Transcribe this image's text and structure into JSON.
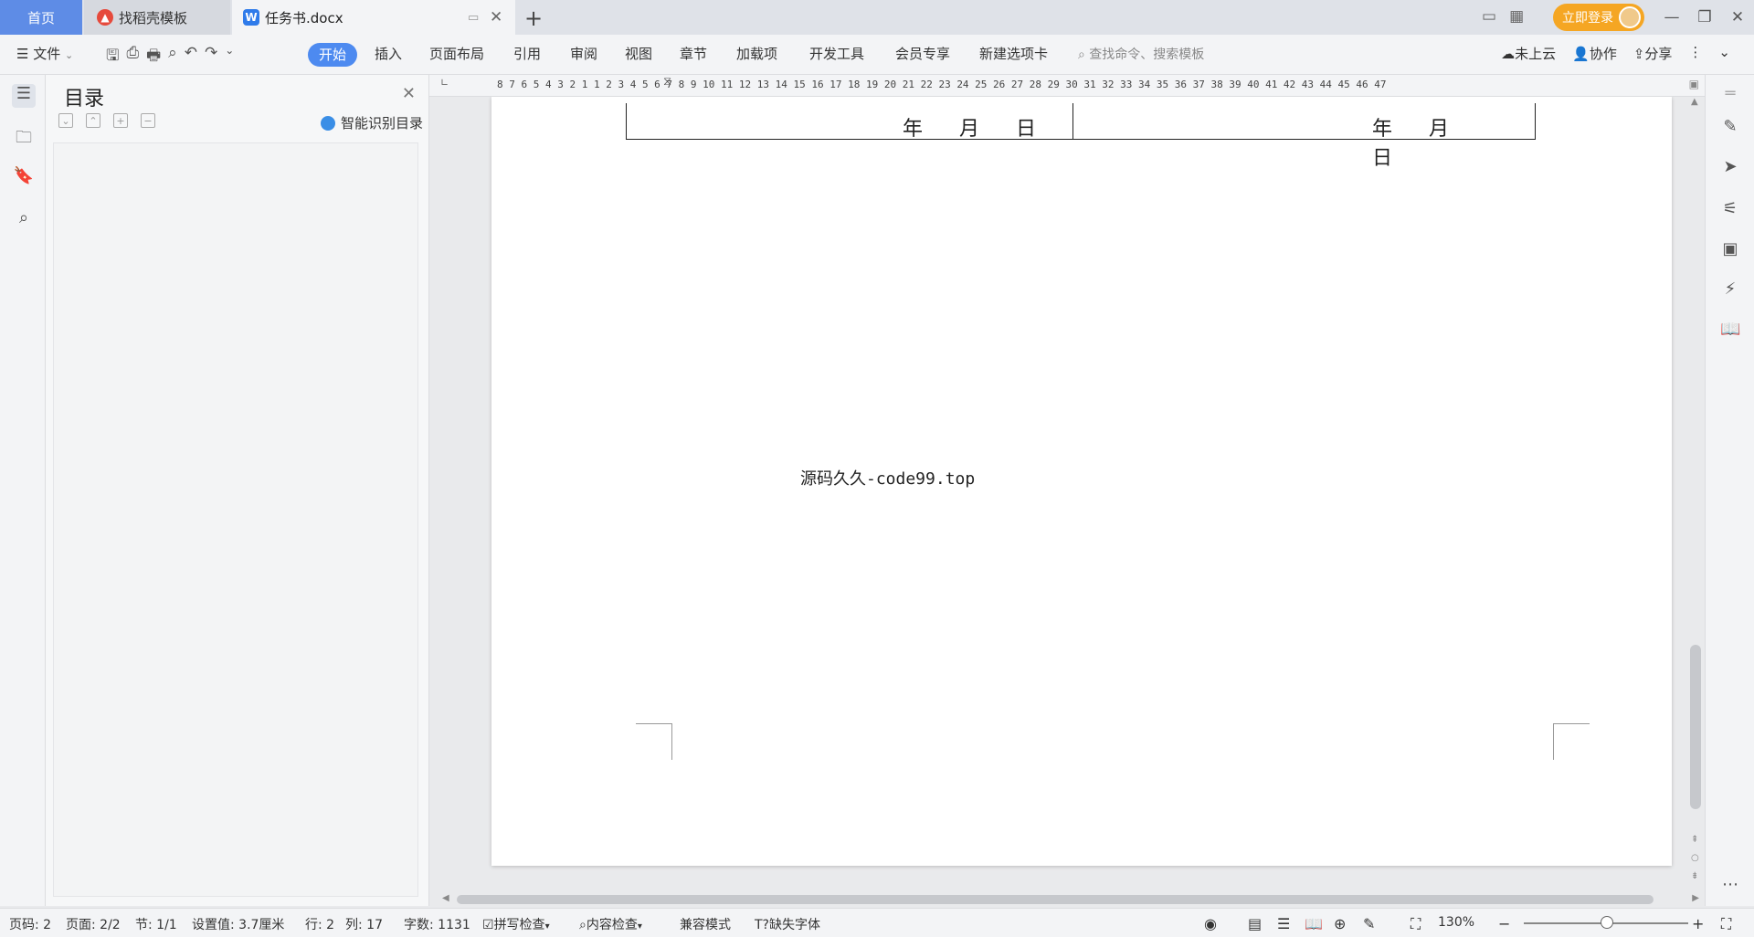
{
  "tabs": {
    "home": "首页",
    "daoke": "找稻壳模板",
    "doc": "任务书.docx",
    "login": "立即登录"
  },
  "menu": {
    "file": "文件",
    "start": "开始",
    "items": [
      "插入",
      "页面布局",
      "引用",
      "审阅",
      "视图",
      "章节",
      "加载项",
      "开发工具",
      "会员专享",
      "新建选项卡"
    ],
    "search_placeholder": "查找命令、搜索模板",
    "cloud": "未上云",
    "collab": "协作",
    "share": "分享"
  },
  "toc": {
    "title": "目录",
    "smart_label": "智能识别目录"
  },
  "ruler": "8  7  6  5  4  3  2  1     1  2  3  4  5  6  7  8  9 10 11 12 13 14 15 16 17 18 19 20 21 22 23 24 25 26 27 28 29 30 31 32 33 34 35 36 37 38 39 40 41 42 43 44 45 46 47",
  "document": {
    "date_left": "年月日",
    "date_right": "年月日",
    "watermark": "源码久久-code99.top"
  },
  "status": {
    "page_code": "页码: 2",
    "pages": "页面: 2/2",
    "section": "节: 1/1",
    "setting": "设置值: 3.7厘米",
    "row": "行: 2",
    "col": "列: 17",
    "words": "字数: 1131",
    "spell": "拼写检查",
    "content": "内容检查",
    "compat": "兼容模式",
    "missing_font": "缺失字体",
    "zoom": "130%"
  }
}
